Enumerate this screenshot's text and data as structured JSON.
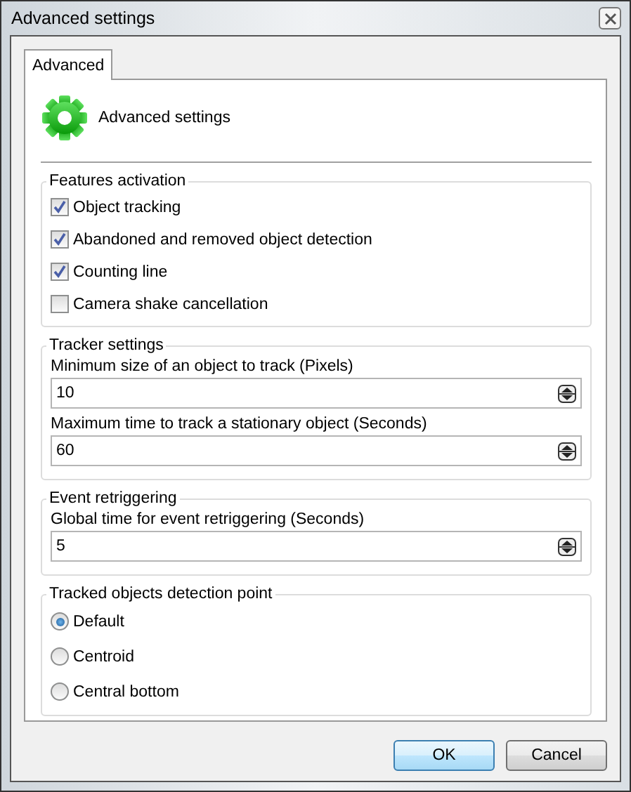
{
  "window": {
    "title": "Advanced settings"
  },
  "tabs": [
    {
      "label": "Advanced",
      "selected": true
    }
  ],
  "header": {
    "title": "Advanced settings"
  },
  "groups": [
    {
      "kind": "checkboxes",
      "title": "Features activation",
      "items": [
        {
          "label": "Object tracking",
          "checked": true
        },
        {
          "label": "Abandoned and removed object detection",
          "checked": true
        },
        {
          "label": "Counting line",
          "checked": true
        },
        {
          "label": "Camera shake cancellation",
          "checked": false
        }
      ]
    },
    {
      "kind": "spinners",
      "title": "Tracker settings",
      "items": [
        {
          "label": "Minimum size of an object to track (Pixels)",
          "value": "10"
        },
        {
          "label": "Maximum time to track a stationary object (Seconds)",
          "value": "60"
        }
      ]
    },
    {
      "kind": "spinners",
      "title": "Event retriggering",
      "items": [
        {
          "label": "Global time for event retriggering (Seconds)",
          "value": "5"
        }
      ]
    },
    {
      "kind": "radios",
      "title": "Tracked objects detection point",
      "items": [
        {
          "label": "Default",
          "selected": true
        },
        {
          "label": "Centroid",
          "selected": false
        },
        {
          "label": "Central bottom",
          "selected": false
        }
      ]
    }
  ],
  "buttons": [
    {
      "label": "OK",
      "default": true
    },
    {
      "label": "Cancel",
      "default": false
    }
  ]
}
